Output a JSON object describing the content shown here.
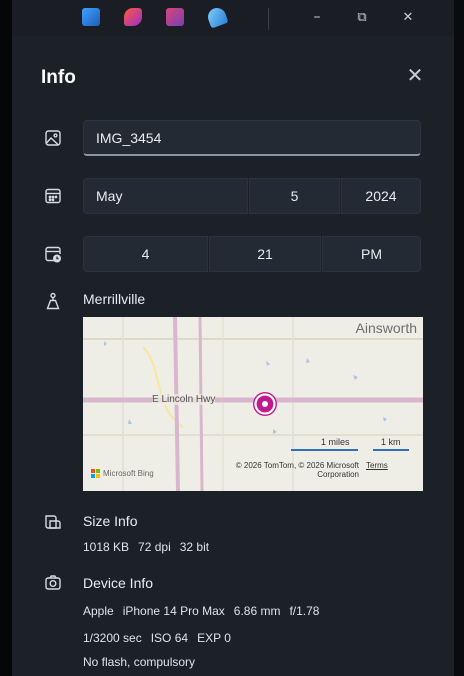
{
  "titlebar": {
    "apps": [
      {
        "icon": "photos-app-icon",
        "color": "#2f7fd6"
      },
      {
        "icon": "clipchamp-app-icon",
        "color": "#c63aa8"
      },
      {
        "icon": "video-app-icon",
        "color": "#b43f8f"
      },
      {
        "icon": "onedrive-app-icon",
        "color": "#4aa6e8"
      }
    ],
    "minimize": "–",
    "restore": "⧉",
    "close": "✕"
  },
  "info": {
    "title": "Info",
    "close": "✕",
    "filename": "IMG_3454",
    "date": {
      "month": "May",
      "day": "5",
      "year": "2024"
    },
    "time": {
      "hour": "4",
      "minute": "21",
      "period": "PM"
    },
    "location": "Merrillville",
    "map": {
      "town": "Ainsworth",
      "road": "E Lincoln Hwy",
      "scale_miles": "1 miles",
      "scale_km": "1 km",
      "copyright": "© 2026 TomTom, © 2026 Microsoft Corporation",
      "terms": "Terms",
      "provider": "Microsoft Bing"
    },
    "size": {
      "title": "Size Info",
      "file_size": "1018 KB",
      "dpi": "72 dpi",
      "bits": "32 bit"
    },
    "device": {
      "title": "Device Info",
      "make": "Apple",
      "model": "iPhone 14 Pro Max",
      "focal": "6.86 mm",
      "aperture": "f/1.78",
      "shutter": "1/3200 sec",
      "iso": "ISO 64",
      "exp": "EXP 0",
      "flash": "No flash, compulsory"
    }
  }
}
